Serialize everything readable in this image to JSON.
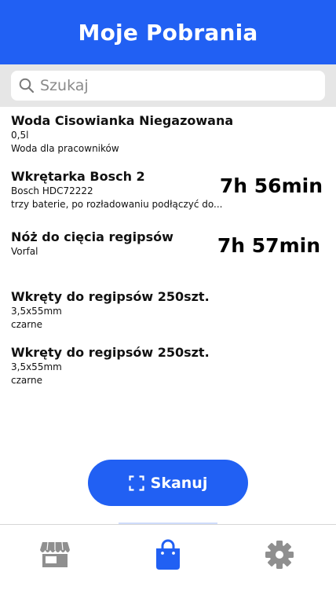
{
  "header": {
    "title": "Moje Pobrania"
  },
  "search": {
    "placeholder": "Szukaj",
    "icon": "search-icon"
  },
  "items": [
    {
      "title": "Woda Cisowianka Niegazowana",
      "line1": "0,5l",
      "line2": "Woda dla pracowników",
      "timer": ""
    },
    {
      "title": "Wkrętarka Bosch 2",
      "line1": "Bosch HDC72222",
      "line2": "trzy baterie, po rozładowaniu podłączyć do...",
      "timer": "7h 56min"
    },
    {
      "title": "Nóż do cięcia regipsów",
      "line1": "Vorfal",
      "line2": "",
      "timer": "7h 57min"
    },
    {
      "title": "Wkręty do regipsów 250szt.",
      "line1": "3,5x55mm",
      "line2": "czarne",
      "timer": ""
    },
    {
      "title": "Wkręty do regipsów 250szt.",
      "line1": "3,5x55mm",
      "line2": "czarne",
      "timer": ""
    }
  ],
  "scan_button": {
    "label": "Skanuj",
    "icon": "scan-frame-icon"
  },
  "tabs": [
    {
      "name": "store",
      "icon": "store-icon",
      "active": false
    },
    {
      "name": "downloads",
      "icon": "shopping-bag-icon",
      "active": true
    },
    {
      "name": "settings",
      "icon": "gear-icon",
      "active": false
    }
  ],
  "colors": {
    "primary": "#2160f3",
    "inactive_icon": "#8f8f8f",
    "search_band": "#e6e6e6"
  }
}
